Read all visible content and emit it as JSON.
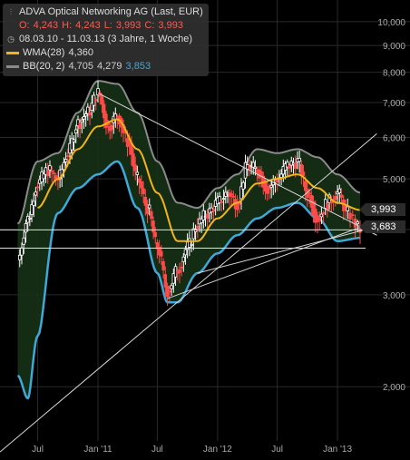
{
  "legend": {
    "title": "ADVA Optical Networking AG (Last, EUR)",
    "ohlc": {
      "o_label": "O:",
      "o_value": "4,243",
      "h_label": "H:",
      "h_value": "4,243",
      "l_label": "L:",
      "l_value": "3,993",
      "c_label": "C:",
      "c_value": "3,993"
    },
    "period": "08.03.10 - 11.03.13 (3 Jahre, 1 Woche)",
    "wma_label": "WMA(28)",
    "wma_value": "4,360",
    "bb_label": "BB(20, 2)",
    "bb_upper": "4,705",
    "bb_mid": "4,279",
    "bb_lower": "3,853",
    "icons": [
      "chart-type-icon",
      "clock-icon"
    ]
  },
  "colors": {
    "candle_up": "#ffffff",
    "candle_down": "#ff4a4a",
    "wma": "#f2b416",
    "bb_upper": "#8a8a8a",
    "bb_lower": "#3ea8d8",
    "bb_fill": "#163016",
    "trendline": "#d8d8d8",
    "background": "#000000",
    "grid": "#2a2a2a"
  },
  "chart_data": {
    "type": "candlestick",
    "scale": "log",
    "ylim": [
      1600,
      11000
    ],
    "xlim": [
      "2010-03-08",
      "2013-03-11"
    ],
    "y_ticks": [
      2000,
      3000,
      4000,
      5000,
      6000,
      7000,
      8000,
      9000,
      10000
    ],
    "y_tick_labels": [
      "2,000",
      "3,000",
      "",
      "5,000",
      "6,000",
      "7,000",
      "8,000",
      "9,000",
      "10,000"
    ],
    "x_ticks": [
      {
        "date": "2010-07-01",
        "label": "Jul"
      },
      {
        "date": "2011-01-01",
        "label": "Jan '11"
      },
      {
        "date": "2011-07-01",
        "label": "Jul"
      },
      {
        "date": "2012-01-01",
        "label": "Jan '12"
      },
      {
        "date": "2012-07-01",
        "label": "Jul"
      },
      {
        "date": "2013-01-01",
        "label": "Jan '13"
      }
    ],
    "series_points": [
      {
        "d": "2010-05-01",
        "c": 3500
      },
      {
        "d": "2010-06-01",
        "c": 4200
      },
      {
        "d": "2010-07-01",
        "c": 4900
      },
      {
        "d": "2010-08-01",
        "c": 5200
      },
      {
        "d": "2010-09-01",
        "c": 5000
      },
      {
        "d": "2010-10-01",
        "c": 5600
      },
      {
        "d": "2010-11-01",
        "c": 6400
      },
      {
        "d": "2010-12-01",
        "c": 6700
      },
      {
        "d": "2011-01-01",
        "c": 7300
      },
      {
        "d": "2011-02-01",
        "c": 6300
      },
      {
        "d": "2011-03-01",
        "c": 6600
      },
      {
        "d": "2011-04-01",
        "c": 5900
      },
      {
        "d": "2011-05-01",
        "c": 5000
      },
      {
        "d": "2011-06-01",
        "c": 4400
      },
      {
        "d": "2011-07-01",
        "c": 3700
      },
      {
        "d": "2011-08-01",
        "c": 3050
      },
      {
        "d": "2011-09-01",
        "c": 3350
      },
      {
        "d": "2011-10-01",
        "c": 3700
      },
      {
        "d": "2011-11-01",
        "c": 4100
      },
      {
        "d": "2011-12-01",
        "c": 4300
      },
      {
        "d": "2012-01-01",
        "c": 4500
      },
      {
        "d": "2012-02-01",
        "c": 4700
      },
      {
        "d": "2012-03-01",
        "c": 4500
      },
      {
        "d": "2012-04-01",
        "c": 5300
      },
      {
        "d": "2012-05-01",
        "c": 5200
      },
      {
        "d": "2012-06-01",
        "c": 4800
      },
      {
        "d": "2012-07-01",
        "c": 5000
      },
      {
        "d": "2012-08-01",
        "c": 5300
      },
      {
        "d": "2012-09-01",
        "c": 5400
      },
      {
        "d": "2012-10-01",
        "c": 4700
      },
      {
        "d": "2012-11-01",
        "c": 4200
      },
      {
        "d": "2012-12-01",
        "c": 4500
      },
      {
        "d": "2013-01-01",
        "c": 4700
      },
      {
        "d": "2013-02-01",
        "c": 4300
      },
      {
        "d": "2013-03-11",
        "c": 3993
      }
    ],
    "wma_points": [
      {
        "d": "2010-07-01",
        "v": 4400
      },
      {
        "d": "2010-09-01",
        "v": 5000
      },
      {
        "d": "2010-11-01",
        "v": 5700
      },
      {
        "d": "2011-01-01",
        "v": 6300
      },
      {
        "d": "2011-03-01",
        "v": 6500
      },
      {
        "d": "2011-05-01",
        "v": 5700
      },
      {
        "d": "2011-07-01",
        "v": 4700
      },
      {
        "d": "2011-09-01",
        "v": 3800
      },
      {
        "d": "2011-11-01",
        "v": 3800
      },
      {
        "d": "2012-01-01",
        "v": 4200
      },
      {
        "d": "2012-03-01",
        "v": 4500
      },
      {
        "d": "2012-05-01",
        "v": 4900
      },
      {
        "d": "2012-07-01",
        "v": 5000
      },
      {
        "d": "2012-09-01",
        "v": 5100
      },
      {
        "d": "2012-11-01",
        "v": 4800
      },
      {
        "d": "2013-01-01",
        "v": 4500
      },
      {
        "d": "2013-03-11",
        "v": 4360
      }
    ],
    "bb_upper_points": [
      {
        "d": "2010-05-01",
        "v": 4100
      },
      {
        "d": "2010-07-01",
        "v": 5400
      },
      {
        "d": "2010-09-01",
        "v": 5600
      },
      {
        "d": "2010-11-01",
        "v": 6700
      },
      {
        "d": "2011-01-01",
        "v": 7700
      },
      {
        "d": "2011-03-01",
        "v": 7600
      },
      {
        "d": "2011-05-01",
        "v": 6700
      },
      {
        "d": "2011-07-01",
        "v": 5400
      },
      {
        "d": "2011-09-01",
        "v": 4500
      },
      {
        "d": "2011-11-01",
        "v": 4400
      },
      {
        "d": "2012-01-01",
        "v": 4800
      },
      {
        "d": "2012-03-01",
        "v": 5100
      },
      {
        "d": "2012-05-01",
        "v": 5700
      },
      {
        "d": "2012-07-01",
        "v": 5600
      },
      {
        "d": "2012-09-01",
        "v": 5700
      },
      {
        "d": "2012-11-01",
        "v": 5500
      },
      {
        "d": "2013-01-01",
        "v": 5100
      },
      {
        "d": "2013-03-11",
        "v": 4705
      }
    ],
    "bb_lower_points": [
      {
        "d": "2010-05-01",
        "v": 2100
      },
      {
        "d": "2010-06-01",
        "v": 1900
      },
      {
        "d": "2010-07-01",
        "v": 2500
      },
      {
        "d": "2010-09-01",
        "v": 4300
      },
      {
        "d": "2010-11-01",
        "v": 4800
      },
      {
        "d": "2011-01-01",
        "v": 5100
      },
      {
        "d": "2011-03-01",
        "v": 5400
      },
      {
        "d": "2011-05-01",
        "v": 4400
      },
      {
        "d": "2011-07-01",
        "v": 3300
      },
      {
        "d": "2011-08-01",
        "v": 2900
      },
      {
        "d": "2011-09-01",
        "v": 2900
      },
      {
        "d": "2011-11-01",
        "v": 3300
      },
      {
        "d": "2012-01-01",
        "v": 3600
      },
      {
        "d": "2012-03-01",
        "v": 3900
      },
      {
        "d": "2012-05-01",
        "v": 4200
      },
      {
        "d": "2012-07-01",
        "v": 4400
      },
      {
        "d": "2012-09-01",
        "v": 4500
      },
      {
        "d": "2012-11-01",
        "v": 4200
      },
      {
        "d": "2013-01-01",
        "v": 3800
      },
      {
        "d": "2013-03-11",
        "v": 3853
      }
    ],
    "trendlines": [
      {
        "from": {
          "d": "2011-01-01",
          "v": 7300
        },
        "to": {
          "d": "2013-05-01",
          "v": 3900
        }
      },
      {
        "from": {
          "d": "2010-03-08",
          "v": 1500
        },
        "to": {
          "d": "2013-05-01",
          "v": 6100
        }
      },
      {
        "from": {
          "d": "2011-08-01",
          "v": 2950
        },
        "to": {
          "d": "2013-05-01",
          "v": 4150
        }
      },
      {
        "from": {
          "d": "2011-11-01",
          "v": 3300
        },
        "to": {
          "d": "2013-05-01",
          "v": 4050
        }
      }
    ],
    "reference_levels": [
      {
        "value": 3993,
        "label": "3,993"
      },
      {
        "value": 3683,
        "label": "3,683"
      }
    ]
  }
}
